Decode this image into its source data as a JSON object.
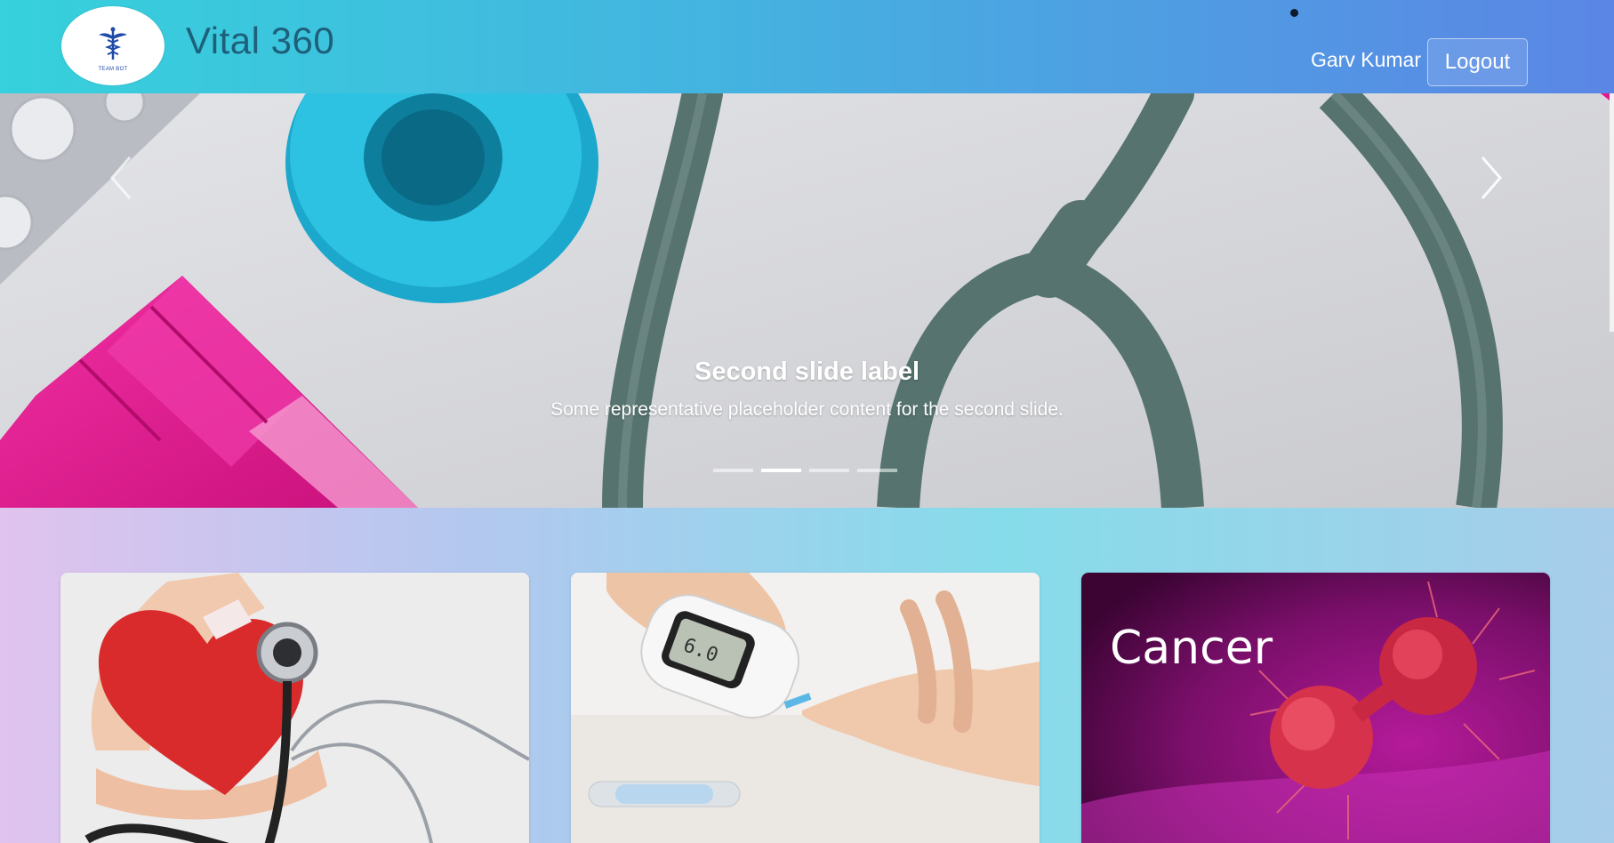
{
  "header": {
    "brand_title": "Vital 360",
    "logo_caption": "TEAM BOT",
    "user_name": "Garv Kumar",
    "logout_label": "Logout"
  },
  "carousel": {
    "active_slide": 2,
    "slide_count": 4,
    "caption_title": "Second slide label",
    "caption_text": "Some representative placeholder content for the second slide.",
    "icons": {
      "prev": "chevron-left-icon",
      "next": "chevron-right-icon"
    }
  },
  "cards": [
    {
      "name": "heart-stethoscope",
      "label": ""
    },
    {
      "name": "glucose-meter",
      "label": ""
    },
    {
      "name": "cancer",
      "label": "Cancer"
    }
  ],
  "colors": {
    "header_start": "#36d1dc",
    "header_end": "#5b86e5",
    "brand_text": "#1e5f7a",
    "accent_pink": "#e4178f",
    "accent_cyan": "#23b3d8"
  }
}
